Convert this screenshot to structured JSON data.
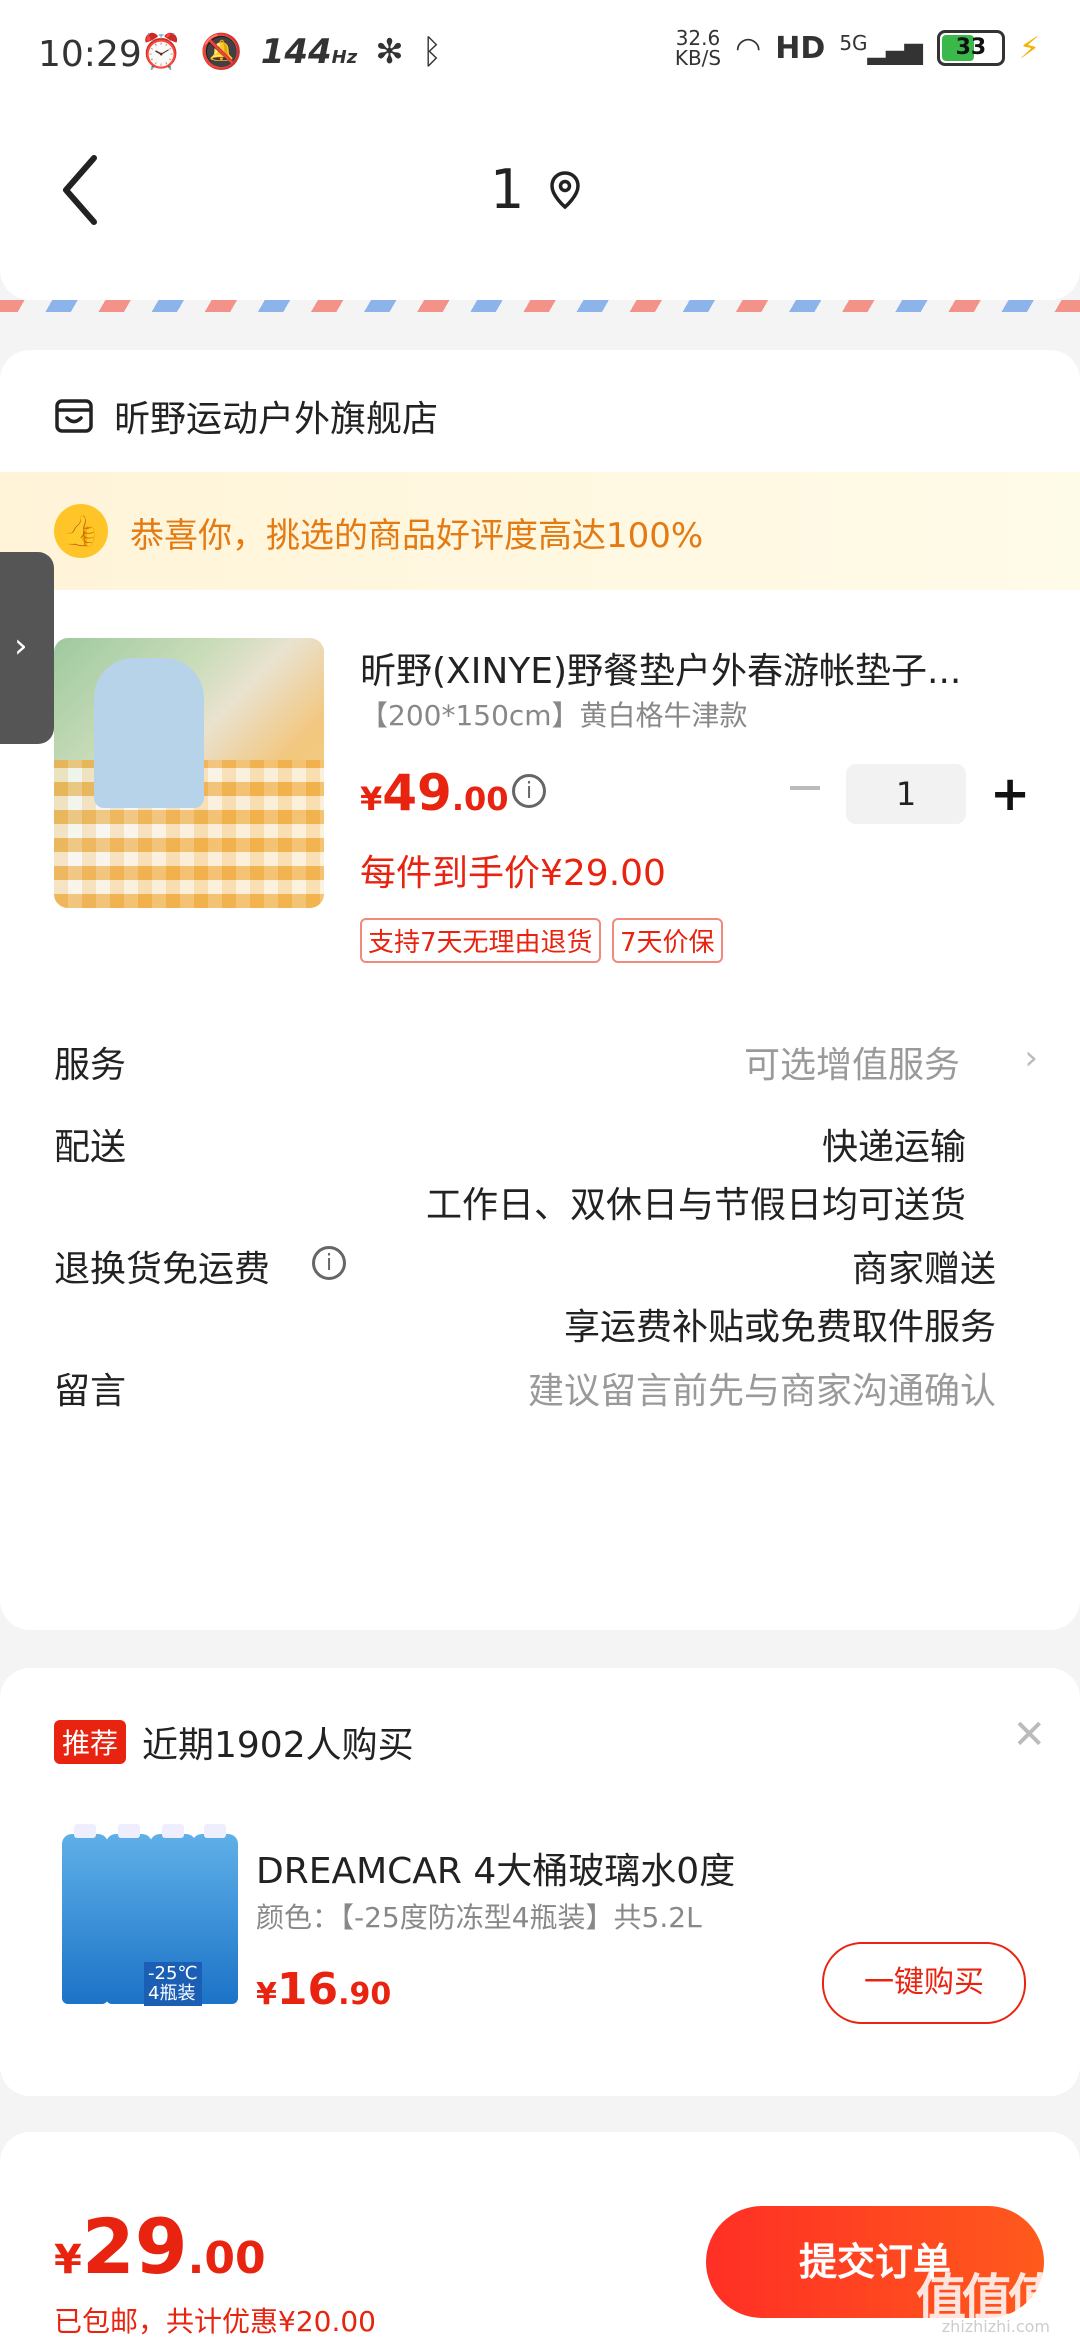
{
  "status_bar": {
    "time": "10:29",
    "refresh": "144",
    "refresh_unit": "Hz",
    "speed_value": "32.6",
    "speed_unit": "KB/S",
    "hd": "HD",
    "network": "5G",
    "battery": "33"
  },
  "header": {
    "address_name": "1"
  },
  "store": {
    "name": "昕野运动户外旗舰店"
  },
  "praise_banner": {
    "text": "恭喜你，挑选的商品好评度高达100%"
  },
  "product": {
    "title": "昕野(XINYE)野餐垫户外春游帐垫子...",
    "spec": "【200*150cm】黄白格牛津款",
    "price_yen": "¥",
    "price_int": "49",
    "price_dec": ".00",
    "quantity": "1",
    "arrival_price": "每件到手价¥29.00",
    "tags": [
      "支持7天无理由退货",
      "7天价保"
    ]
  },
  "rows": {
    "service_label": "服务",
    "service_value": "可选增值服务",
    "delivery_label": "配送",
    "delivery_value": "快递运输",
    "delivery_note": "工作日、双休日与节假日均可送货",
    "return_label": "退换货免运费",
    "return_value": "商家赠送",
    "return_note": "享运费补贴或免费取件服务",
    "message_label": "留言",
    "message_placeholder": "建议留言前先与商家沟通确认"
  },
  "recommend": {
    "badge": "推荐",
    "title": "近期1902人购买",
    "item_name": "DREAMCAR 4大桶玻璃水0度",
    "item_spec": "颜色：【-25度防冻型4瓶装】共5.2L",
    "image_label_1": "-25℃",
    "image_label_2": "4瓶装",
    "price_yen": "¥",
    "price_int": "16",
    "price_dec": ".90",
    "buy_label": "一键购买"
  },
  "footer": {
    "total_yen": "¥",
    "total_int": "29",
    "total_dec": ".00",
    "note": "已包邮，共计优惠¥20.00",
    "submit_label": "提交订单",
    "watermark": "值值值",
    "watermark_sub": "zhizhizhi.com"
  }
}
